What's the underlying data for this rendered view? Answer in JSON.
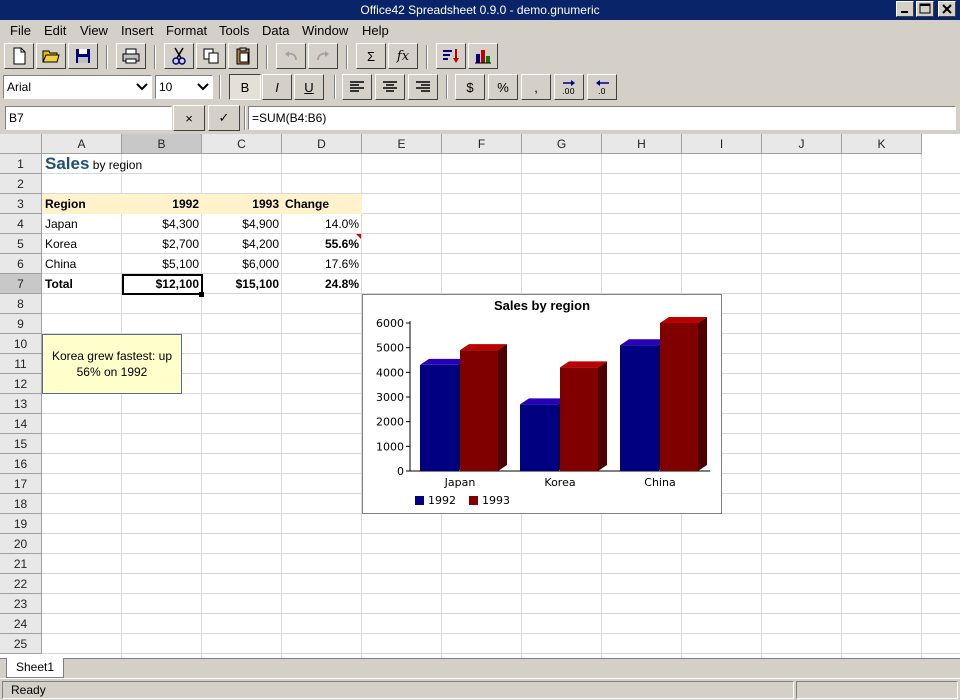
{
  "window": {
    "title": "Office42 Spreadsheet 0.9.0 - demo.gnumeric"
  },
  "menu": [
    "File",
    "Edit",
    "View",
    "Insert",
    "Format",
    "Tools",
    "Data",
    "Window",
    "Help"
  ],
  "toolbar": {
    "sum_label": "Σ",
    "fx_label": "fx"
  },
  "format_bar": {
    "font_name": "Arial",
    "font_size": "10",
    "bold_label": "B",
    "italic_label": "I",
    "underline_label": "U",
    "currency_label": "$",
    "percent_label": "%",
    "comma_label": ","
  },
  "formula_bar": {
    "cell_ref": "B7",
    "cancel_label": "×",
    "accept_label": "✓",
    "formula": "=SUM(B4:B6)"
  },
  "grid": {
    "columns": [
      "A",
      "B",
      "C",
      "D",
      "E",
      "F",
      "G",
      "H",
      "I",
      "J",
      "K"
    ],
    "rows": [
      "1",
      "2",
      "3",
      "4",
      "5",
      "6",
      "7",
      "8",
      "9",
      "10",
      "11",
      "12",
      "13",
      "14",
      "15",
      "16",
      "17",
      "18",
      "19",
      "20",
      "21",
      "22",
      "23",
      "24",
      "25"
    ],
    "active_col": "B",
    "active_row": "7",
    "title_main": "Sales",
    "title_rest": " by region",
    "header": [
      "Region",
      "1992",
      "1993",
      "Change"
    ],
    "data": [
      [
        "Japan",
        "$4,300",
        "$4,900",
        "14.0%"
      ],
      [
        "Korea",
        "$2,700",
        "$4,200",
        "55.6%"
      ],
      [
        "China",
        "$5,100",
        "$6,000",
        "17.6%"
      ],
      [
        "Total",
        "$12,100",
        "$15,100",
        "24.8%"
      ]
    ]
  },
  "note": {
    "text": "Korea grew fastest: up 56% on 1992"
  },
  "chart_data": {
    "type": "bar",
    "title": "Sales by region",
    "categories": [
      "Japan",
      "Korea",
      "China"
    ],
    "series": [
      {
        "name": "1992",
        "values": [
          4300,
          2700,
          5100
        ],
        "color": "#000080"
      },
      {
        "name": "1993",
        "values": [
          4900,
          4200,
          6000
        ],
        "color": "#800000"
      }
    ],
    "ylim": [
      0,
      6000
    ],
    "yticks": [
      0,
      1000,
      2000,
      3000,
      4000,
      5000,
      6000
    ],
    "legend": "bottom-left",
    "grid": false
  },
  "sheets": [
    "Sheet1"
  ],
  "status": {
    "text": "Ready"
  }
}
